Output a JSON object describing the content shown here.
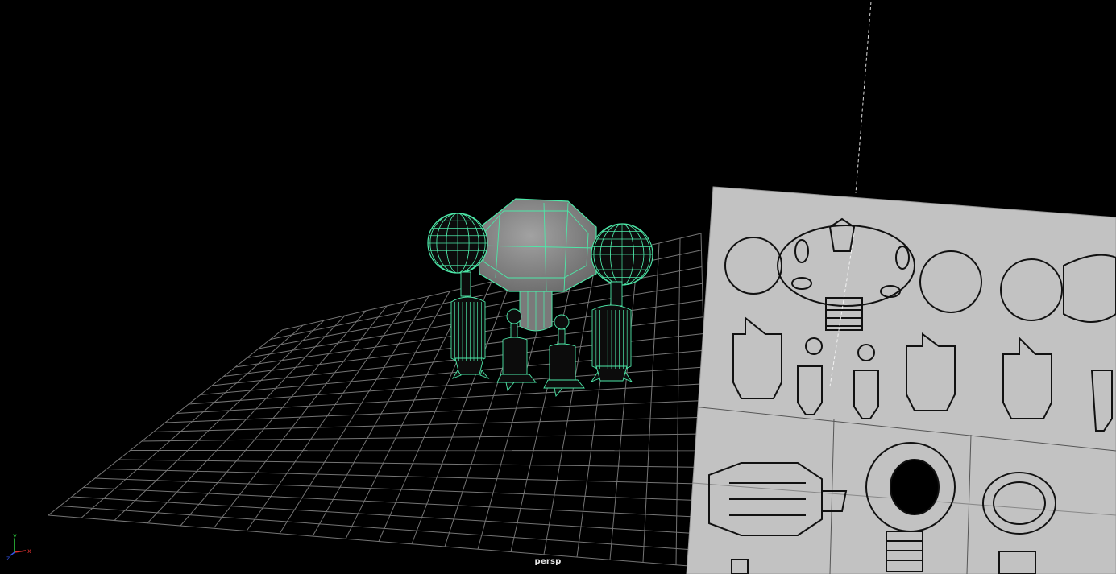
{
  "viewport": {
    "camera_name": "persp",
    "background_color": "#000000",
    "grid_color": "#8a8a8a",
    "selection_wire_color": "#4de8a8",
    "mesh_shade_color": "#8c8c8c",
    "image_plane_color": "#c2c2c2"
  },
  "axis_gizmo": {
    "x_label": "x",
    "y_label": "y",
    "z_label": "z",
    "x_color": "#e03030",
    "y_color": "#30d040",
    "z_color": "#3050e0"
  },
  "scene": {
    "selected_object": "robot-model",
    "image_plane": "reference-sketch-image-plane"
  }
}
